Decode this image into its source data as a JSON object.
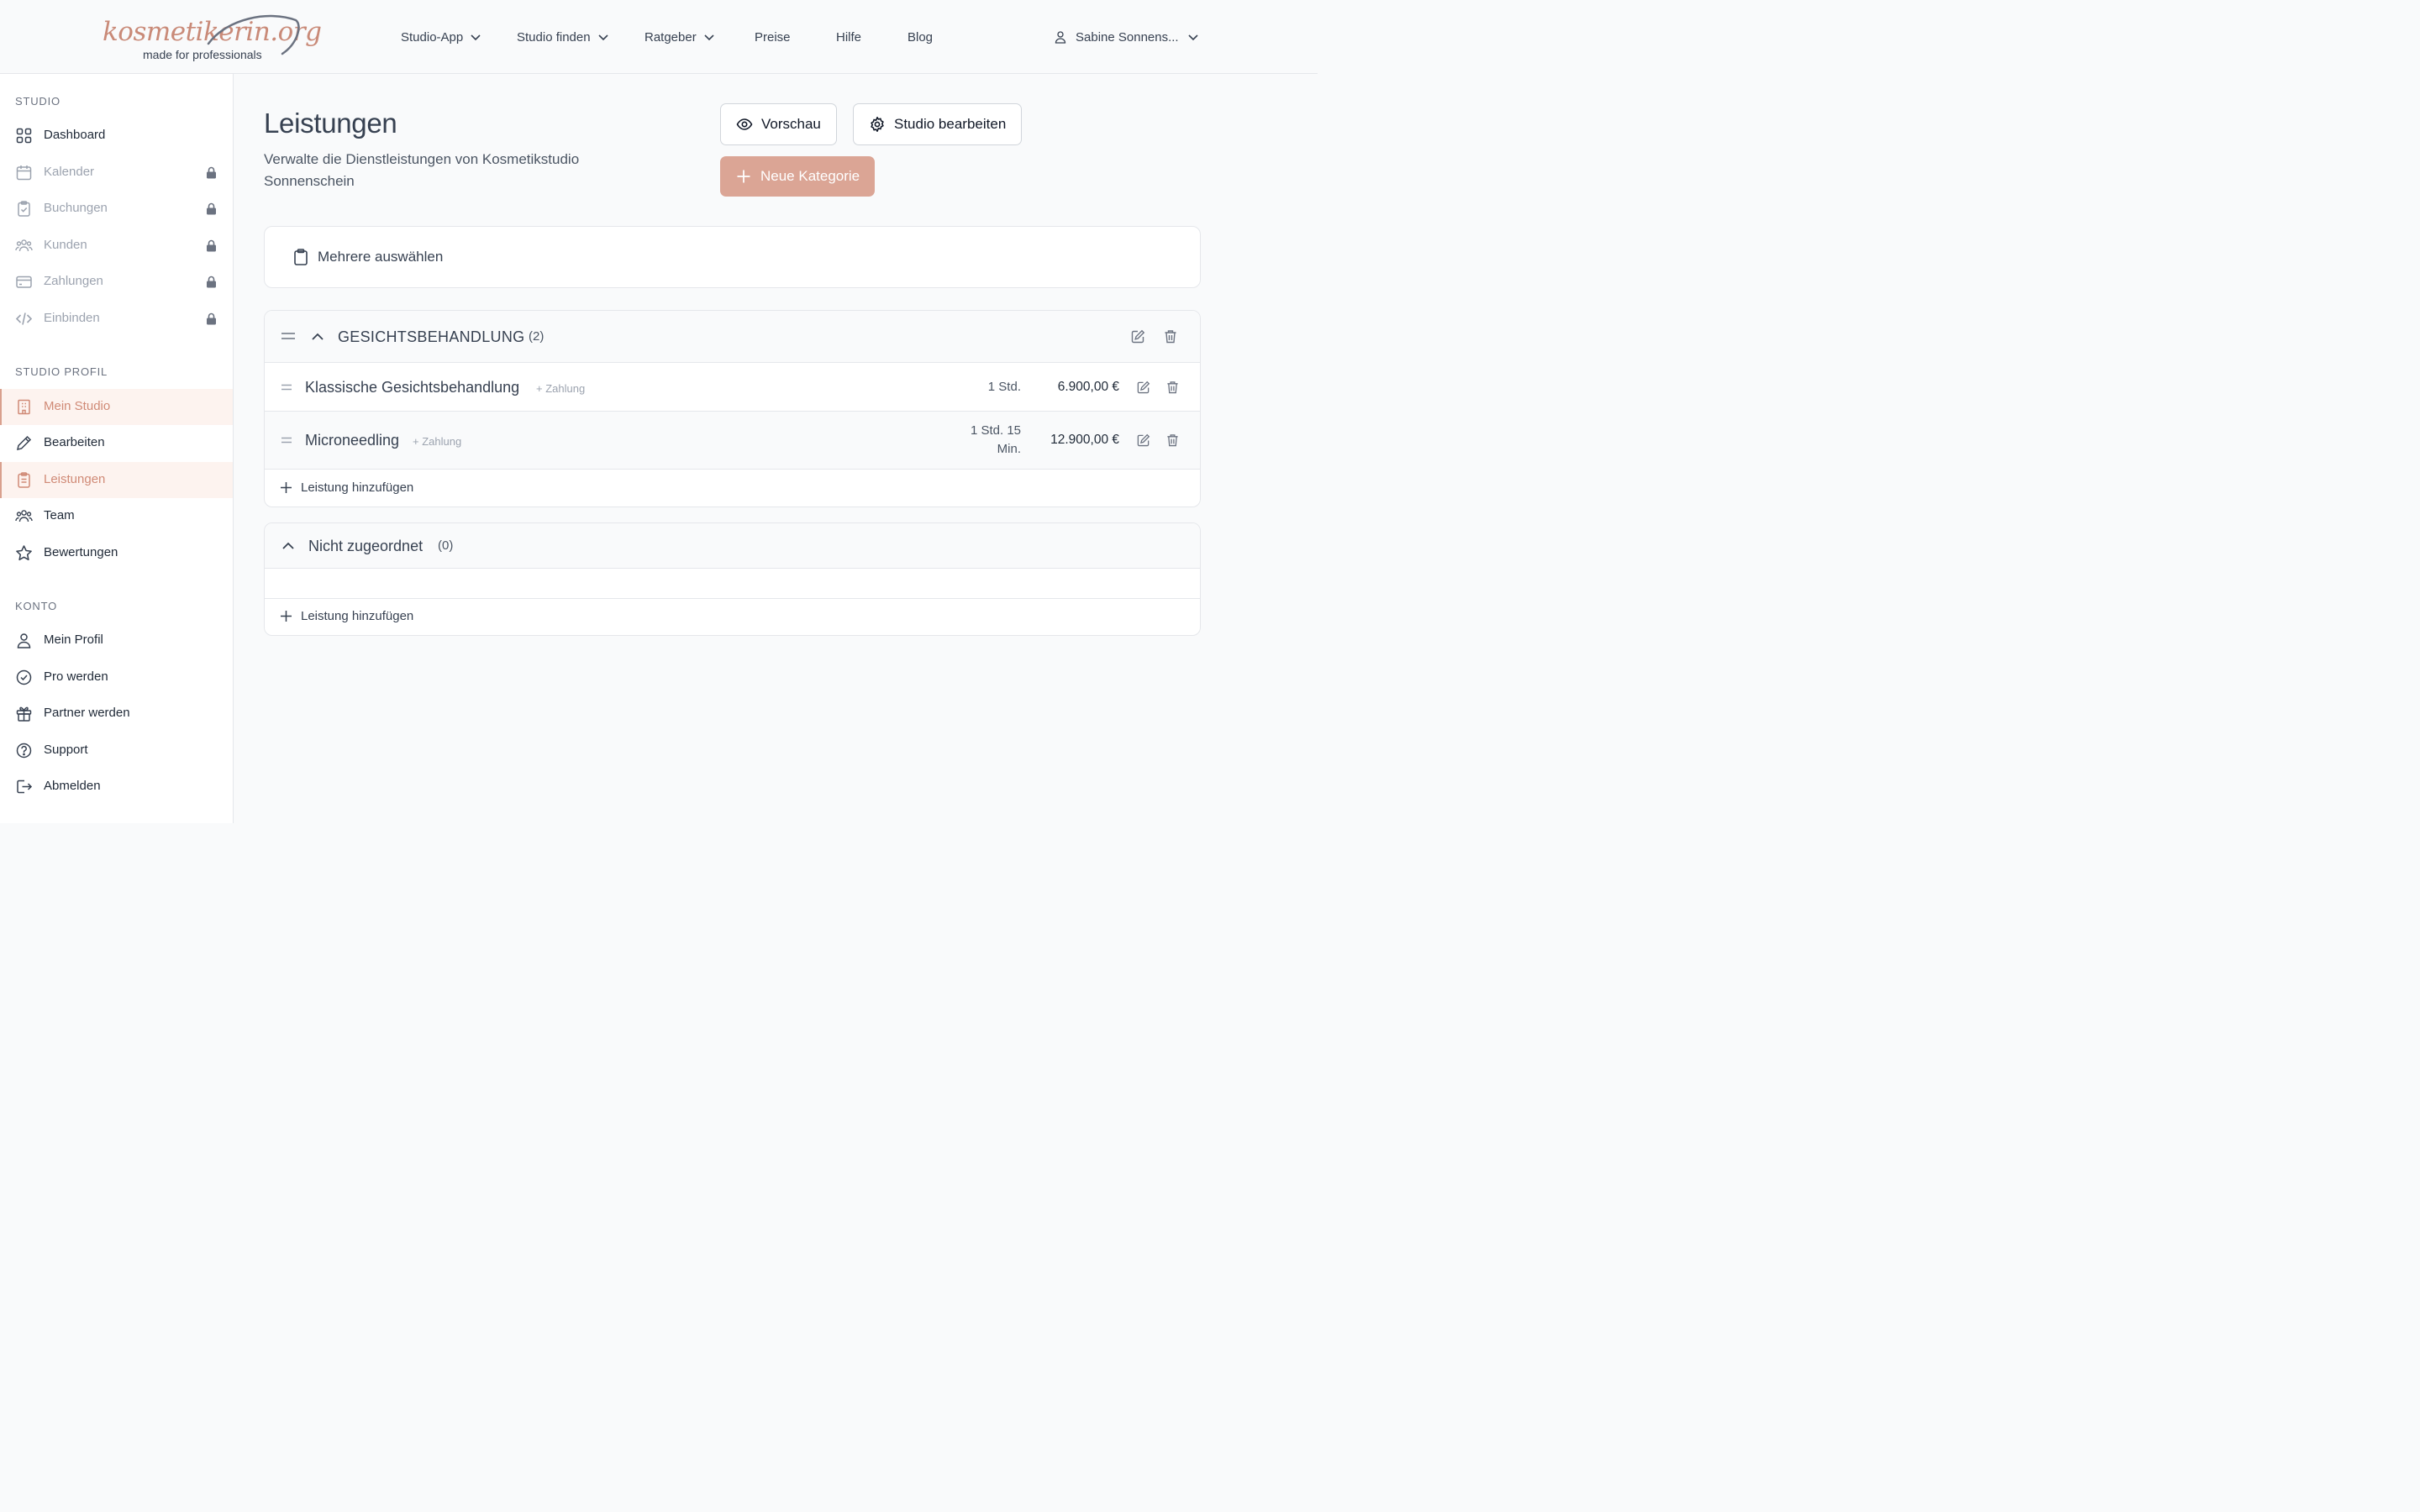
{
  "brand": {
    "logo_text": "kosmetikerin.org",
    "tagline": "made for professionals",
    "accent_color": "#dba595"
  },
  "header": {
    "nav": [
      {
        "label": "Studio-App",
        "has_dropdown": true
      },
      {
        "label": "Studio finden",
        "has_dropdown": true
      },
      {
        "label": "Ratgeber",
        "has_dropdown": true
      },
      {
        "label": "Preise",
        "has_dropdown": false
      },
      {
        "label": "Hilfe",
        "has_dropdown": false
      },
      {
        "label": "Blog",
        "has_dropdown": false
      }
    ],
    "user_name": "Sabine Sonnens..."
  },
  "sidebar": {
    "sections": [
      {
        "heading": "STUDIO",
        "items": [
          {
            "label": "Dashboard",
            "icon": "grid-icon",
            "locked": false,
            "active": false
          },
          {
            "label": "Kalender",
            "icon": "calendar-icon",
            "locked": true,
            "active": false
          },
          {
            "label": "Buchungen",
            "icon": "clipboard-check-icon",
            "locked": true,
            "active": false
          },
          {
            "label": "Kunden",
            "icon": "users-icon",
            "locked": true,
            "active": false
          },
          {
            "label": "Zahlungen",
            "icon": "credit-card-icon",
            "locked": true,
            "active": false
          },
          {
            "label": "Einbinden",
            "icon": "code-icon",
            "locked": true,
            "active": false
          }
        ]
      },
      {
        "heading": "STUDIO PROFIL",
        "items": [
          {
            "label": "Mein Studio",
            "icon": "building-icon",
            "locked": false,
            "active": true
          },
          {
            "label": "Bearbeiten",
            "icon": "pencil-icon",
            "locked": false,
            "active": false
          },
          {
            "label": "Leistungen",
            "icon": "clipboard-list-icon",
            "locked": false,
            "active": true
          },
          {
            "label": "Team",
            "icon": "team-icon",
            "locked": false,
            "active": false
          },
          {
            "label": "Bewertungen",
            "icon": "star-icon",
            "locked": false,
            "active": false
          }
        ]
      },
      {
        "heading": "KONTO",
        "items": [
          {
            "label": "Mein Profil",
            "icon": "user-icon",
            "locked": false,
            "active": false
          },
          {
            "label": "Pro werden",
            "icon": "badge-check-icon",
            "locked": false,
            "active": false
          },
          {
            "label": "Partner werden",
            "icon": "gift-icon",
            "locked": false,
            "active": false
          },
          {
            "label": "Support",
            "icon": "help-circle-icon",
            "locked": false,
            "active": false
          },
          {
            "label": "Abmelden",
            "icon": "logout-icon",
            "locked": false,
            "active": false
          }
        ]
      }
    ]
  },
  "main": {
    "title": "Leistungen",
    "description": "Verwalte die Dienstleistungen von Kosmetikstudio Sonnenschein",
    "buttons": {
      "preview": "Vorschau",
      "edit_studio": "Studio bearbeiten",
      "new_category": "Neue Kategorie"
    },
    "select_multiple": "Mehrere auswählen",
    "categories": [
      {
        "name": "GESICHTSBEHANDLUNG",
        "count": "(2)",
        "services": [
          {
            "name": "Klassische Gesichtsbehandlung",
            "tag": "+ Zahlung",
            "duration": "1 Std.",
            "price": "6.900,00 €"
          },
          {
            "name": "Microneedling",
            "tag": "+ Zahlung",
            "duration": "1 Std. 15 Min.",
            "price": "12.900,00 €"
          }
        ],
        "add_label": "Leistung hinzufügen"
      },
      {
        "name": "Nicht zugeordnet",
        "count": "(0)",
        "services": [],
        "add_label": "Leistung hinzufügen"
      }
    ]
  }
}
